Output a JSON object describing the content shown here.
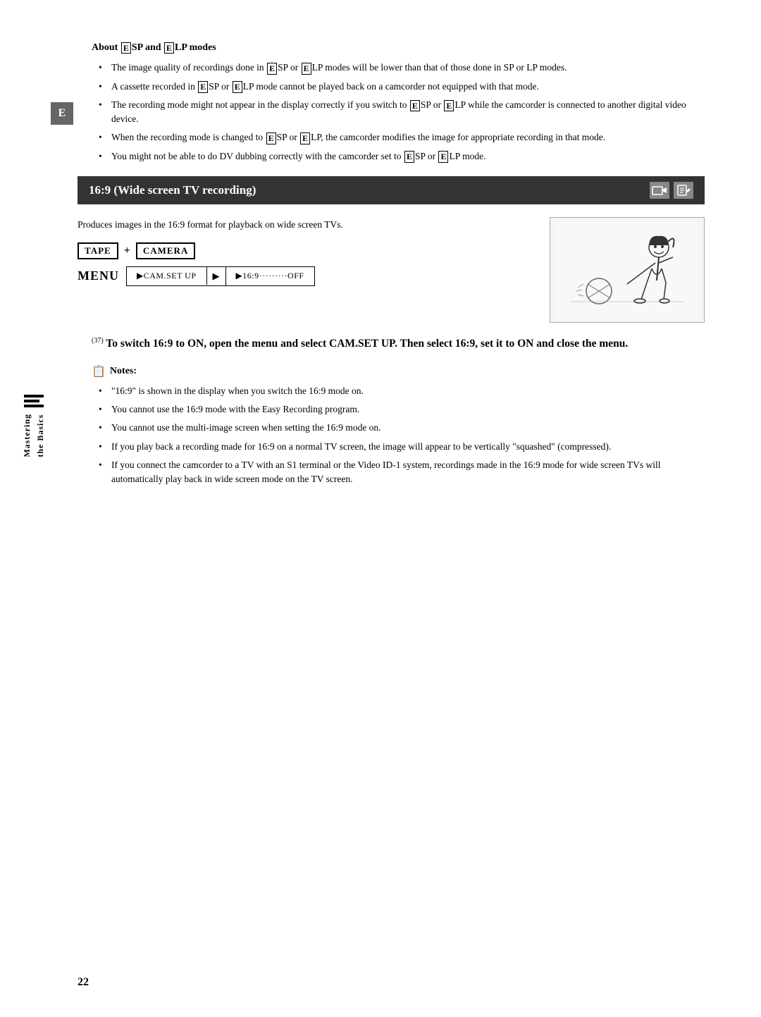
{
  "page": {
    "number": "22",
    "e_badge": "E"
  },
  "sidebar": {
    "line1": "",
    "line2": "",
    "line3": "",
    "text1": "Mastering",
    "text2": "the Basics"
  },
  "about_section": {
    "heading": "About ◣SP and ◣LP modes",
    "bullets": [
      "The image quality of recordings done in ◣SP or ◣LP modes will be lower than that of those done in SP or LP modes.",
      "A cassette recorded in ◣SP or ◣LP mode cannot be played back on a camcorder not equipped with that mode.",
      "The recording mode might not appear in the display correctly if you switch to ◣SP or ◣LP while the camcorder is connected to another digital video device.",
      "When the recording mode is changed to ◣SP or ◣LP, the camcorder modifies the image for appropriate recording in that mode.",
      "You might not be able to do DV dubbing correctly with the camcorder set to ◣SP or ◣LP mode."
    ]
  },
  "wide_screen_section": {
    "title": "16:9 (Wide screen TV recording)",
    "description": "Produces images in the 16:9 format for playback on wide screen TVs.",
    "tape_label": "TAPE",
    "plus": "+",
    "camera_label": "CAMERA",
    "menu_label": "MENU",
    "menu_path_1": "▶CAM.SET UP",
    "menu_arrow": "▶",
    "menu_path_2": "▶16:9·········OFF",
    "ref": "37",
    "instruction": "To switch 16:9 to ON, open the menu and select CAM.SET UP. Then select 16:9, set it to ON and close the menu.",
    "notes_heading": "Notes:",
    "notes": [
      "“16:9” is shown in the display when you switch the 16:9 mode on.",
      "You cannot use the 16:9 mode with the Easy Recording program.",
      "You cannot use the multi-image screen when setting the 16:9 mode on.",
      "If you play back a recording made for 16:9 on a normal TV screen, the image will appear to be vertically “squashed” (compressed).",
      "If you connect the camcorder to a TV with an S1 terminal or the Video ID-1 system, recordings made in the 16:9 mode for wide screen TVs will automatically play back in wide screen mode on the TV screen."
    ]
  }
}
